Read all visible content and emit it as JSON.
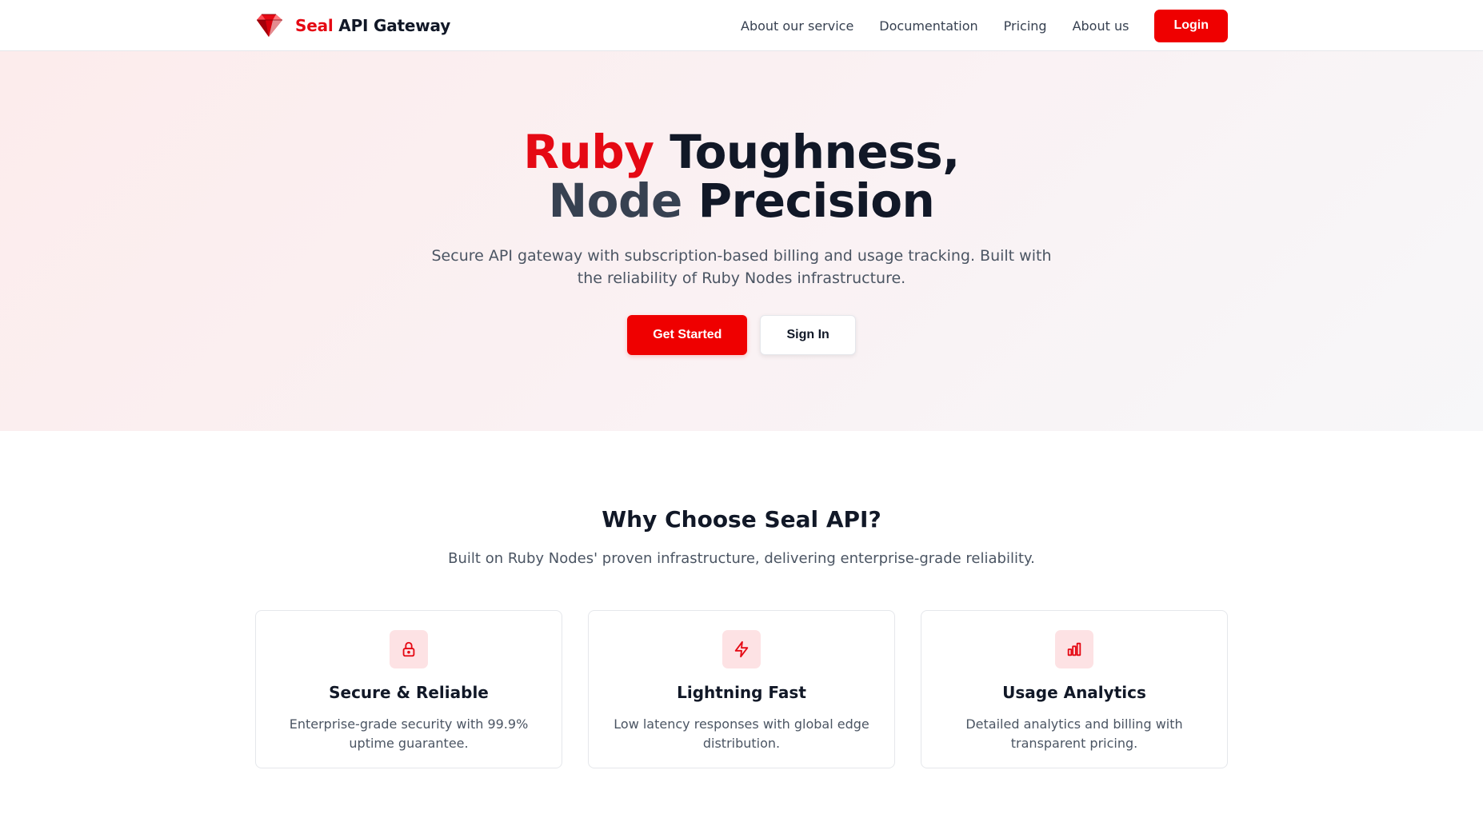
{
  "header": {
    "brand_accent": "Seal",
    "brand_rest": " API Gateway",
    "logo_icon": "ruby-gem-icon",
    "nav": [
      {
        "label": "About our service"
      },
      {
        "label": "Documentation"
      },
      {
        "label": "Pricing"
      },
      {
        "label": "About us"
      }
    ],
    "login_label": "Login"
  },
  "hero": {
    "title_red": "Ruby",
    "title_rest_line1": " Toughness,",
    "title_slate": "Node",
    "title_rest_line2": " Precision",
    "subtitle": "Secure API gateway with subscription-based billing and usage tracking. Built with the reliability of Ruby Nodes infrastructure.",
    "primary_label": "Get Started",
    "secondary_label": "Sign In"
  },
  "features": {
    "title": "Why Choose Seal API?",
    "subtitle": "Built on Ruby Nodes' proven infrastructure, delivering enterprise-grade reliability.",
    "cards": [
      {
        "icon": "lock-icon",
        "title": "Secure & Reliable",
        "desc": "Enterprise-grade security with 99.9% uptime guarantee."
      },
      {
        "icon": "lightning-icon",
        "title": "Lightning Fast",
        "desc": "Low latency responses with global edge distribution."
      },
      {
        "icon": "bar-chart-icon",
        "title": "Usage Analytics",
        "desc": "Detailed analytics and billing with transparent pricing."
      }
    ]
  },
  "colors": {
    "accent": "#ef0000",
    "brand_red": "#e50914",
    "icon_bg": "#fde2e4"
  }
}
